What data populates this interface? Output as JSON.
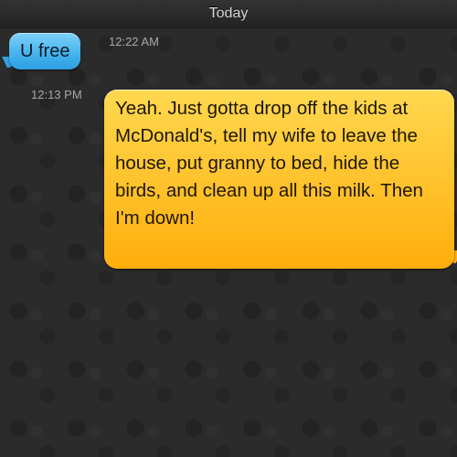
{
  "header": {
    "title": "Today"
  },
  "messages": [
    {
      "direction": "incoming",
      "text": "U free",
      "time": "12:22 AM",
      "color": "#43b1ee"
    },
    {
      "direction": "outgoing",
      "text": "Yeah. Just gotta drop off the kids at McDonald's, tell my wife to leave the house, put granny to bed, hide the birds, and clean up all this milk. Then I'm down!",
      "time": "12:13 PM",
      "color": "#ffc12a"
    }
  ],
  "colors": {
    "background": "#2b2b2b",
    "header": "#2a2a2a",
    "timestamp": "#a7a7a7"
  }
}
